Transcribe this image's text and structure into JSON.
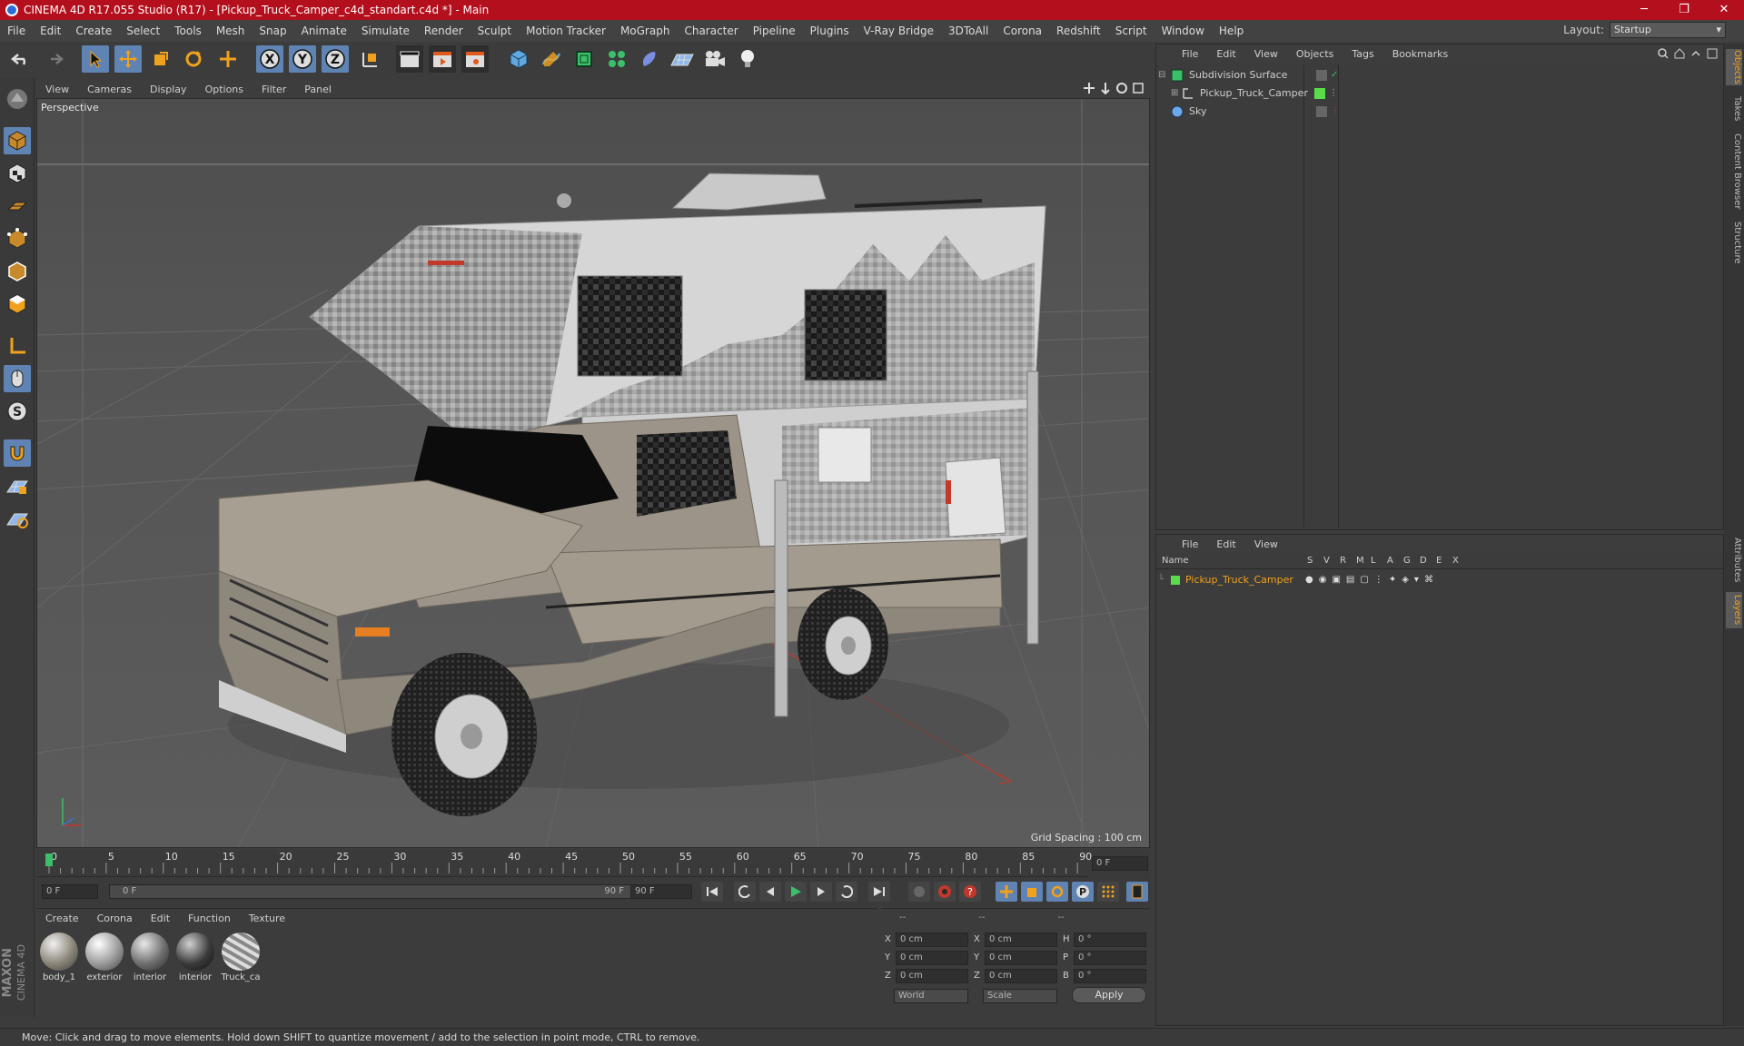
{
  "window": {
    "title": "CINEMA 4D R17.055 Studio (R17) - [Pickup_Truck_Camper_c4d_standart.c4d *] - Main",
    "minimize": "─",
    "maximize": "❐",
    "close": "✕"
  },
  "menu": [
    "File",
    "Edit",
    "Create",
    "Select",
    "Tools",
    "Mesh",
    "Snap",
    "Animate",
    "Simulate",
    "Render",
    "Sculpt",
    "Motion Tracker",
    "MoGraph",
    "Character",
    "Pipeline",
    "Plugins",
    "V-Ray Bridge",
    "3DToAll",
    "Corona",
    "Redshift",
    "Script",
    "Window",
    "Help"
  ],
  "layout": {
    "label": "Layout:",
    "value": "Startup"
  },
  "toolbar": {
    "x": "X",
    "y": "Y",
    "z": "Z"
  },
  "viewport": {
    "menu": [
      "View",
      "Cameras",
      "Display",
      "Options",
      "Filter",
      "Panel"
    ],
    "label": "Perspective",
    "grid_spacing": "Grid Spacing : 100 cm"
  },
  "timeline": {
    "ticks": [
      "0",
      "5",
      "10",
      "15",
      "20",
      "25",
      "30",
      "35",
      "40",
      "45",
      "50",
      "55",
      "60",
      "65",
      "70",
      "75",
      "80",
      "85",
      "90"
    ],
    "current_frame": "0 F",
    "start": "0 F",
    "range_start": "0 F",
    "range_end": "90 F",
    "end": "90 F"
  },
  "materials": {
    "menu": [
      "Create",
      "Corona",
      "Edit",
      "Function",
      "Texture"
    ],
    "items": [
      {
        "name": "body_1"
      },
      {
        "name": "exterior"
      },
      {
        "name": "interior"
      },
      {
        "name": "interior"
      },
      {
        "name": "Truck_ca"
      }
    ]
  },
  "coordinates": {
    "header": [
      "--",
      "--",
      "--"
    ],
    "rows": [
      {
        "a": "X",
        "av": "0 cm",
        "b": "X",
        "bv": "0 cm",
        "c": "H",
        "cv": "0 °"
      },
      {
        "a": "Y",
        "av": "0 cm",
        "b": "Y",
        "bv": "0 cm",
        "c": "P",
        "cv": "0 °"
      },
      {
        "a": "Z",
        "av": "0 cm",
        "b": "Z",
        "bv": "0 cm",
        "c": "B",
        "cv": "0 °"
      }
    ],
    "world": "World",
    "scale": "Scale",
    "apply": "Apply"
  },
  "objects": {
    "menu": [
      "File",
      "Edit",
      "View",
      "Objects",
      "Tags",
      "Bookmarks"
    ],
    "items": [
      {
        "name": "Subdivision Surface"
      },
      {
        "name": "Pickup_Truck_Camper"
      },
      {
        "name": "Sky"
      }
    ]
  },
  "layers": {
    "menu": [
      "File",
      "Edit",
      "View"
    ],
    "columns": [
      "Name",
      "S",
      "V",
      "R",
      "M",
      "L",
      "A",
      "G",
      "D",
      "E",
      "X"
    ],
    "items": [
      {
        "name": "Pickup_Truck_Camper"
      }
    ]
  },
  "side_tabs": [
    "Objects",
    "Takes",
    "Content Browser",
    "Structure"
  ],
  "side_tabs_lower": [
    "Attributes",
    "Layers"
  ],
  "brand": {
    "line1": "MAXON",
    "line2": "CINEMA 4D"
  },
  "status": "Move: Click and drag to move elements. Hold down SHIFT to quantize movement / add to the selection in point mode, CTRL to remove.",
  "colors": {
    "titlebar": "#b30f1c",
    "accent": "#5f84b4",
    "highlight": "#f0a11d"
  }
}
